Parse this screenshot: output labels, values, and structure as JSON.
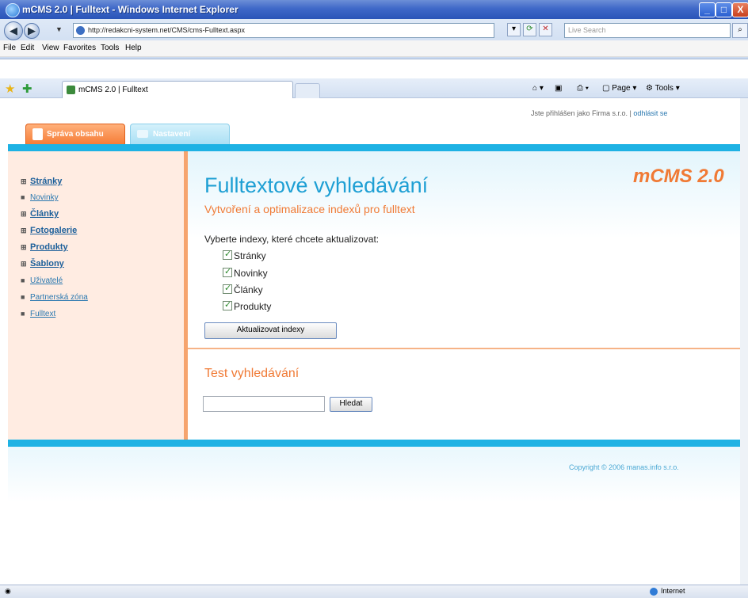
{
  "window": {
    "title": "mCMS 2.0 | Fulltext - Windows Internet Explorer",
    "minimize_symbol": "_",
    "maximize_symbol": "□",
    "close_symbol": "X"
  },
  "browser": {
    "url": "http://redakcni-system.net/CMS/cms-Fulltext.aspx",
    "search_placeholder": "Live Search",
    "menu": [
      "File",
      "Edit",
      "View",
      "Favorites",
      "Tools",
      "Help"
    ],
    "tab_title": "mCMS 2.0 | Fulltext",
    "page_label": "Page",
    "tools_label": "Tools",
    "status_zone": "Internet"
  },
  "header": {
    "login_text": "Jste přihlášen jako Firma s.r.o. | ",
    "logout_link": "odhlásit se",
    "tabs": [
      "Správa obsahu",
      "Nastavení"
    ]
  },
  "sidebar": {
    "items": [
      {
        "label": "Stránky",
        "marker": "⊞"
      },
      {
        "label": "Novinky",
        "marker": "■"
      },
      {
        "label": "Články",
        "marker": "⊞"
      },
      {
        "label": "Fotogalerie",
        "marker": "⊞"
      },
      {
        "label": "Produkty",
        "marker": "⊞"
      },
      {
        "label": "Šablony",
        "marker": "⊞"
      },
      {
        "label": "Uživatelé",
        "marker": "■"
      },
      {
        "label": "Partnerská zóna",
        "marker": "■"
      },
      {
        "label": "Fulltext",
        "marker": "■"
      }
    ]
  },
  "main": {
    "title": "Fulltextové vyhledávání",
    "subtitle": "Vytvoření a optimalizace indexů pro fulltext",
    "brand": "mCMS 2.0",
    "select_label": "Vyberte indexy, které chcete aktualizovat:",
    "checkboxes": [
      {
        "label": "Stránky",
        "checked": true
      },
      {
        "label": "Novinky",
        "checked": true
      },
      {
        "label": "Články",
        "checked": true
      },
      {
        "label": "Produkty",
        "checked": true
      }
    ],
    "update_button": "Aktualizovat indexy",
    "test_title": "Test vyhledávání",
    "search_value": "",
    "search_button": "Hledat"
  },
  "footer": {
    "copyright": "Copyright © 2006 manas.info s.r.o."
  },
  "colors": {
    "accent_blue": "#1eb2e4",
    "accent_orange": "#f07a35",
    "sidebar_bg": "#ffece2"
  }
}
